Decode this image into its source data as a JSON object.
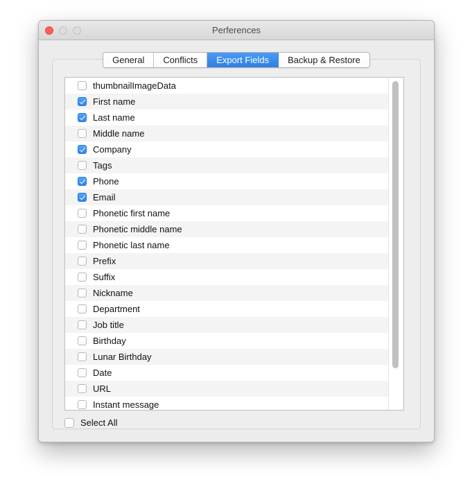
{
  "window": {
    "title": "Perferences",
    "controls": {
      "close": "close-button",
      "minimize": "minimize-button",
      "zoom": "zoom-button"
    }
  },
  "tabs": [
    {
      "label": "General",
      "selected": false
    },
    {
      "label": "Conflicts",
      "selected": false
    },
    {
      "label": "Export Fields",
      "selected": true
    },
    {
      "label": "Backup & Restore",
      "selected": false
    }
  ],
  "export_fields": {
    "rows": [
      {
        "label": "thumbnailImageData",
        "checked": false
      },
      {
        "label": "First name",
        "checked": true
      },
      {
        "label": "Last name",
        "checked": true
      },
      {
        "label": "Middle name",
        "checked": false
      },
      {
        "label": "Company",
        "checked": true
      },
      {
        "label": "Tags",
        "checked": false
      },
      {
        "label": "Phone",
        "checked": true
      },
      {
        "label": "Email",
        "checked": true
      },
      {
        "label": "Phonetic first name",
        "checked": false
      },
      {
        "label": "Phonetic middle name",
        "checked": false
      },
      {
        "label": "Phonetic last name",
        "checked": false
      },
      {
        "label": "Prefix",
        "checked": false
      },
      {
        "label": "Suffix",
        "checked": false
      },
      {
        "label": "Nickname",
        "checked": false
      },
      {
        "label": "Department",
        "checked": false
      },
      {
        "label": "Job title",
        "checked": false
      },
      {
        "label": "Birthday",
        "checked": false
      },
      {
        "label": "Lunar Birthday",
        "checked": false
      },
      {
        "label": "Date",
        "checked": false
      },
      {
        "label": "URL",
        "checked": false
      },
      {
        "label": "Instant message",
        "checked": false
      }
    ],
    "select_all": {
      "label": "Select All",
      "checked": false
    }
  },
  "colors": {
    "accent_blue": "#3b8ef0",
    "checkbox_blue": "#3f8ef5",
    "window_bg": "#ececec",
    "row_alt": "#f4f4f4",
    "close_red": "#fc6058"
  }
}
